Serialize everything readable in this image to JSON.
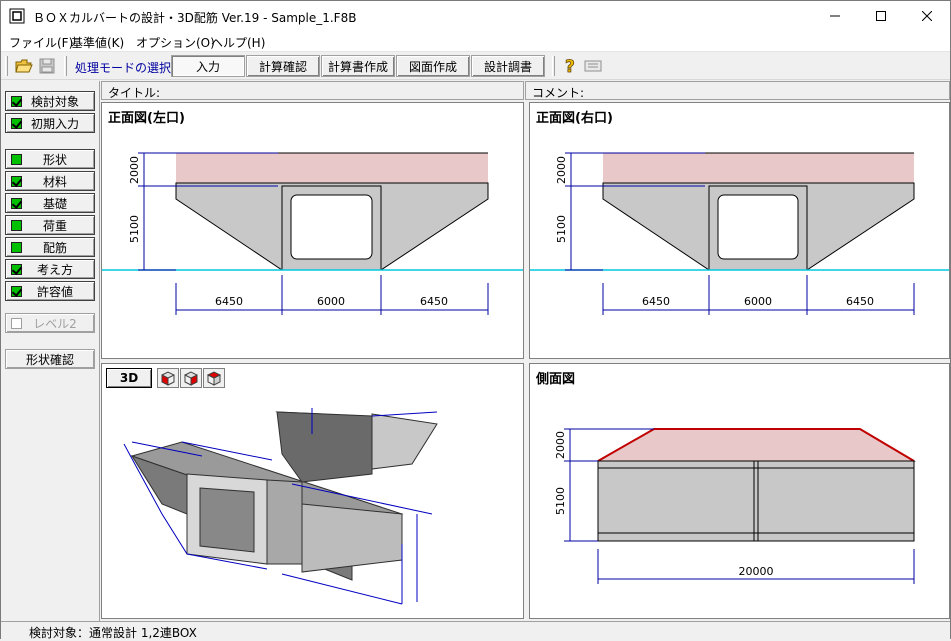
{
  "window": {
    "title": "ＢＯＸカルバートの設計・3D配筋 Ver.19 - Sample_1.F8B"
  },
  "menu": {
    "items": [
      "ファイル(F)",
      "基準値(K)",
      "オプション(O)",
      "ヘルプ(H)"
    ]
  },
  "toolbar": {
    "mode_label": "処理モードの選択",
    "modes": [
      "入力",
      "計算確認",
      "計算書作成",
      "図面作成",
      "設計調書"
    ]
  },
  "sidebar": {
    "items": [
      {
        "label": "検討対象",
        "state": "checked"
      },
      {
        "label": "初期入力",
        "state": "checked"
      },
      {
        "label": "形状",
        "state": "green"
      },
      {
        "label": "材料",
        "state": "checked"
      },
      {
        "label": "基礎",
        "state": "checked"
      },
      {
        "label": "荷重",
        "state": "green"
      },
      {
        "label": "配筋",
        "state": "green"
      },
      {
        "label": "考え方",
        "state": "checked"
      },
      {
        "label": "許容値",
        "state": "checked"
      },
      {
        "label": "レベル2",
        "state": "disabled"
      }
    ],
    "shape_check_label": "形状確認"
  },
  "header": {
    "title_label": "タイトル:",
    "comment_label": "コメント:"
  },
  "panes": {
    "front_left": {
      "title": "正面図(左口)",
      "dims": {
        "h1": "2000",
        "h2": "5100",
        "w1": "6450",
        "w2": "6000",
        "w3": "6450"
      }
    },
    "front_right": {
      "title": "正面図(右口)",
      "dims": {
        "h1": "2000",
        "h2": "5100",
        "w1": "6450",
        "w2": "6000",
        "w3": "6450"
      }
    },
    "view3d": {
      "button_label": "3D"
    },
    "side": {
      "title": "側面図",
      "dims": {
        "h1": "2000",
        "h2": "5100",
        "length": "20000"
      }
    }
  },
  "status": {
    "text": "検討対象：通常設計 1,2連BOX"
  },
  "colors": {
    "soil": "#e8c8c8",
    "concrete": "#c8c8c8",
    "water_line": "#00c8e0",
    "dimension": "#0000a0",
    "check_green": "#00c000",
    "side_top": "#c00000"
  }
}
